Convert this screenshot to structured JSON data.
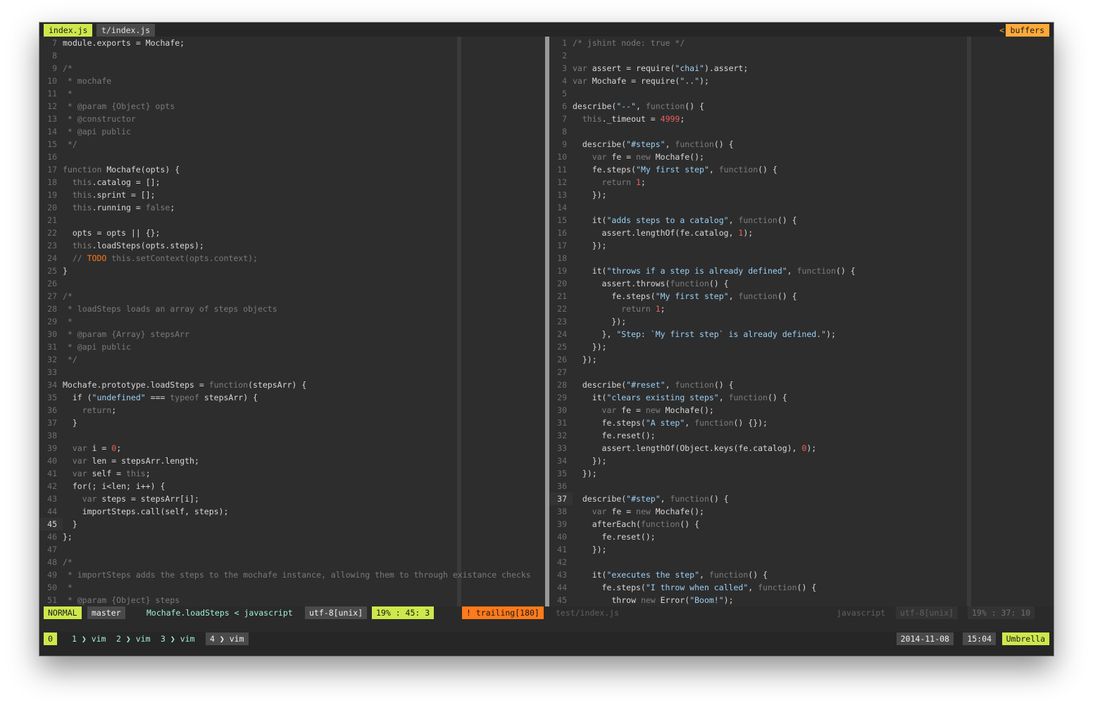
{
  "tabs": [
    {
      "label": "index.js"
    },
    {
      "label": "t/index.js"
    }
  ],
  "buffers_label": "buffers",
  "left_lines": [
    {
      "n": "7",
      "t": "module.exports = Mochafe;",
      "k": "plain"
    },
    {
      "n": "8",
      "t": "",
      "k": "plain"
    },
    {
      "n": "9",
      "t": "/*",
      "k": "comment"
    },
    {
      "n": "10",
      "t": " * mochafe",
      "k": "comment"
    },
    {
      "n": "11",
      "t": " *",
      "k": "comment"
    },
    {
      "n": "12",
      "t": " * @param {Object} opts",
      "k": "comment"
    },
    {
      "n": "13",
      "t": " * @constructor",
      "k": "comment"
    },
    {
      "n": "14",
      "t": " * @api public",
      "k": "comment"
    },
    {
      "n": "15",
      "t": " */",
      "k": "comment"
    },
    {
      "n": "16",
      "t": "",
      "k": "plain"
    },
    {
      "n": "17",
      "t": "function Mochafe(opts) {",
      "k": "plain"
    },
    {
      "n": "18",
      "t": "  this.catalog = [];",
      "k": "plain"
    },
    {
      "n": "19",
      "t": "  this.sprint = [];",
      "k": "plain"
    },
    {
      "n": "20",
      "t": "  this.running = false;",
      "k": "plain"
    },
    {
      "n": "21",
      "t": "",
      "k": "plain"
    },
    {
      "n": "22",
      "t": "  opts = opts || {};",
      "k": "plain"
    },
    {
      "n": "23",
      "t": "  this.loadSteps(opts.steps);",
      "k": "plain"
    },
    {
      "n": "24",
      "t": "  // TODO this.setContext(opts.context);",
      "k": "comment"
    },
    {
      "n": "25",
      "t": "}",
      "k": "plain"
    },
    {
      "n": "26",
      "t": "",
      "k": "plain"
    },
    {
      "n": "27",
      "t": "/*",
      "k": "comment"
    },
    {
      "n": "28",
      "t": " * loadSteps loads an array of steps objects",
      "k": "comment"
    },
    {
      "n": "29",
      "t": " *",
      "k": "comment"
    },
    {
      "n": "30",
      "t": " * @param {Array} stepsArr",
      "k": "comment"
    },
    {
      "n": "31",
      "t": " * @api public",
      "k": "comment"
    },
    {
      "n": "32",
      "t": " */",
      "k": "comment"
    },
    {
      "n": "33",
      "t": "",
      "k": "plain"
    },
    {
      "n": "34",
      "t": "Mochafe.prototype.loadSteps = function(stepsArr) {",
      "k": "plain"
    },
    {
      "n": "35",
      "t": "  if (\"undefined\" === typeof stepsArr) {",
      "k": "plain"
    },
    {
      "n": "36",
      "t": "    return;",
      "k": "plain"
    },
    {
      "n": "37",
      "t": "  }",
      "k": "plain"
    },
    {
      "n": "38",
      "t": "",
      "k": "plain"
    },
    {
      "n": "39",
      "t": "  var i = 0;",
      "k": "plain"
    },
    {
      "n": "40",
      "t": "  var len = stepsArr.length;",
      "k": "plain"
    },
    {
      "n": "41",
      "t": "  var self = this;",
      "k": "plain"
    },
    {
      "n": "42",
      "t": "  for(; i<len; i++) {",
      "k": "plain"
    },
    {
      "n": "43",
      "t": "    var steps = stepsArr[i];",
      "k": "plain"
    },
    {
      "n": "44",
      "t": "    importSteps.call(self, steps);",
      "k": "plain"
    },
    {
      "n": "45",
      "t": "  }",
      "k": "plain",
      "cur": true
    },
    {
      "n": "46",
      "t": "};",
      "k": "plain"
    },
    {
      "n": "47",
      "t": "",
      "k": "plain"
    },
    {
      "n": "48",
      "t": "/*",
      "k": "comment"
    },
    {
      "n": "49",
      "t": " * importSteps adds the steps to the mochafe instance, allowing them to through existance checks",
      "k": "comment"
    },
    {
      "n": "50",
      "t": " *",
      "k": "comment"
    },
    {
      "n": "51",
      "t": " * @param {Object} steps",
      "k": "comment"
    }
  ],
  "right_lines": [
    {
      "n": "1",
      "t": "/* jshint node: true */",
      "k": "comment"
    },
    {
      "n": "2",
      "t": "",
      "k": "plain"
    },
    {
      "n": "3",
      "t": "var assert = require(\"chai\").assert;",
      "k": "plain"
    },
    {
      "n": "4",
      "t": "var Mochafe = require(\"..\");",
      "k": "plain"
    },
    {
      "n": "5",
      "t": "",
      "k": "plain"
    },
    {
      "n": "6",
      "t": "describe(\"--\", function() {",
      "k": "plain"
    },
    {
      "n": "7",
      "t": "  this._timeout = 4999;",
      "k": "plain"
    },
    {
      "n": "8",
      "t": "",
      "k": "plain"
    },
    {
      "n": "9",
      "t": "  describe(\"#steps\", function() {",
      "k": "plain"
    },
    {
      "n": "10",
      "t": "    var fe = new Mochafe();",
      "k": "plain"
    },
    {
      "n": "11",
      "t": "    fe.steps(\"My first step\", function() {",
      "k": "plain"
    },
    {
      "n": "12",
      "t": "      return 1;",
      "k": "plain"
    },
    {
      "n": "13",
      "t": "    });",
      "k": "plain"
    },
    {
      "n": "14",
      "t": "",
      "k": "plain"
    },
    {
      "n": "15",
      "t": "    it(\"adds steps to a catalog\", function() {",
      "k": "plain"
    },
    {
      "n": "16",
      "t": "      assert.lengthOf(fe.catalog, 1);",
      "k": "plain"
    },
    {
      "n": "17",
      "t": "    });",
      "k": "plain"
    },
    {
      "n": "18",
      "t": "",
      "k": "plain"
    },
    {
      "n": "19",
      "t": "    it(\"throws if a step is already defined\", function() {",
      "k": "plain"
    },
    {
      "n": "20",
      "t": "      assert.throws(function() {",
      "k": "plain"
    },
    {
      "n": "21",
      "t": "        fe.steps(\"My first step\", function() {",
      "k": "plain"
    },
    {
      "n": "22",
      "t": "          return 1;",
      "k": "plain"
    },
    {
      "n": "23",
      "t": "        });",
      "k": "plain"
    },
    {
      "n": "24",
      "t": "      }, \"Step: `My first step` is already defined.\");",
      "k": "plain"
    },
    {
      "n": "25",
      "t": "    });",
      "k": "plain"
    },
    {
      "n": "26",
      "t": "  });",
      "k": "plain"
    },
    {
      "n": "27",
      "t": "",
      "k": "plain"
    },
    {
      "n": "28",
      "t": "  describe(\"#reset\", function() {",
      "k": "plain"
    },
    {
      "n": "29",
      "t": "    it(\"clears existing steps\", function() {",
      "k": "plain"
    },
    {
      "n": "30",
      "t": "      var fe = new Mochafe();",
      "k": "plain"
    },
    {
      "n": "31",
      "t": "      fe.steps(\"A step\", function() {});",
      "k": "plain"
    },
    {
      "n": "32",
      "t": "      fe.reset();",
      "k": "plain"
    },
    {
      "n": "33",
      "t": "      assert.lengthOf(Object.keys(fe.catalog), 0);",
      "k": "plain"
    },
    {
      "n": "34",
      "t": "    });",
      "k": "plain"
    },
    {
      "n": "35",
      "t": "  });",
      "k": "plain"
    },
    {
      "n": "36",
      "t": "",
      "k": "plain"
    },
    {
      "n": "37",
      "t": "  describe(\"#step\", function() {",
      "k": "plain",
      "cur": true
    },
    {
      "n": "38",
      "t": "    var fe = new Mochafe();",
      "k": "plain"
    },
    {
      "n": "39",
      "t": "    afterEach(function() {",
      "k": "plain"
    },
    {
      "n": "40",
      "t": "      fe.reset();",
      "k": "plain"
    },
    {
      "n": "41",
      "t": "    });",
      "k": "plain"
    },
    {
      "n": "42",
      "t": "",
      "k": "plain"
    },
    {
      "n": "43",
      "t": "    it(\"executes the step\", function() {",
      "k": "plain"
    },
    {
      "n": "44",
      "t": "      fe.steps(\"I throw when called\", function() {",
      "k": "plain"
    },
    {
      "n": "45",
      "t": "        throw new Error(\"Boom!\");",
      "k": "plain"
    }
  ],
  "status": {
    "mode": "NORMAL",
    "branch": "master",
    "function": "Mochafe.loadSteps < javascript",
    "encoding": "utf-8[unix]",
    "position": "19% :  45:  3",
    "trailing": "! trailing[180]",
    "right_file": "test/index.js",
    "right_lang": "javascript",
    "right_encoding": "utf-8[unix]",
    "right_position": "19% :  37: 10"
  },
  "tmux": {
    "session": "0",
    "windows": [
      {
        "num": "1",
        "name": "vim"
      },
      {
        "num": "2",
        "name": "vim"
      },
      {
        "num": "3",
        "name": "vim"
      },
      {
        "num": "4",
        "name": "vim"
      }
    ],
    "date": "2014-11-08",
    "time": "15:04",
    "host": "Umbrella"
  },
  "colors": {
    "accent_green": "#cde84b",
    "accent_orange": "#ffa93a",
    "trailing_orange": "#ff7a1a",
    "string_blue": "#9ad0f5",
    "number_red": "#ef5f5f",
    "teal": "#9ef0d8",
    "background": "#2d2d2d"
  }
}
